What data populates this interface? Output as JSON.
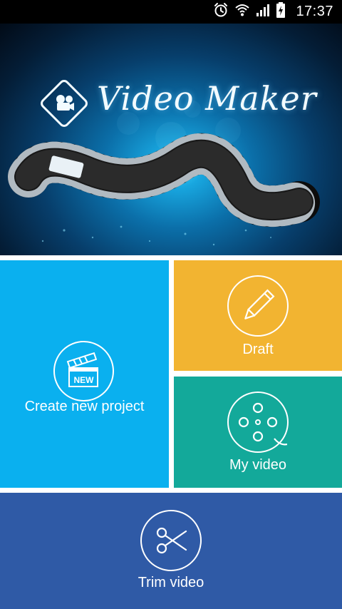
{
  "status_bar": {
    "time": "17:37",
    "icons": [
      "alarm-icon",
      "wifi-icon",
      "signal-icon",
      "battery-charging-icon"
    ]
  },
  "banner": {
    "title": "Video Maker",
    "logo_icon": "camera-diamond-icon"
  },
  "tiles": {
    "create_new_project": {
      "label": "Create new project",
      "badge": "NEW",
      "icon": "clapperboard-icon",
      "color": "#0ab0ef"
    },
    "draft": {
      "label": "Draft",
      "icon": "pencil-icon",
      "color": "#f2b431"
    },
    "my_video": {
      "label": "My video",
      "icon": "film-reel-icon",
      "color": "#13a99a"
    },
    "trim_video": {
      "label": "Trim video",
      "icon": "scissors-icon",
      "color": "#2f5aa6"
    }
  }
}
